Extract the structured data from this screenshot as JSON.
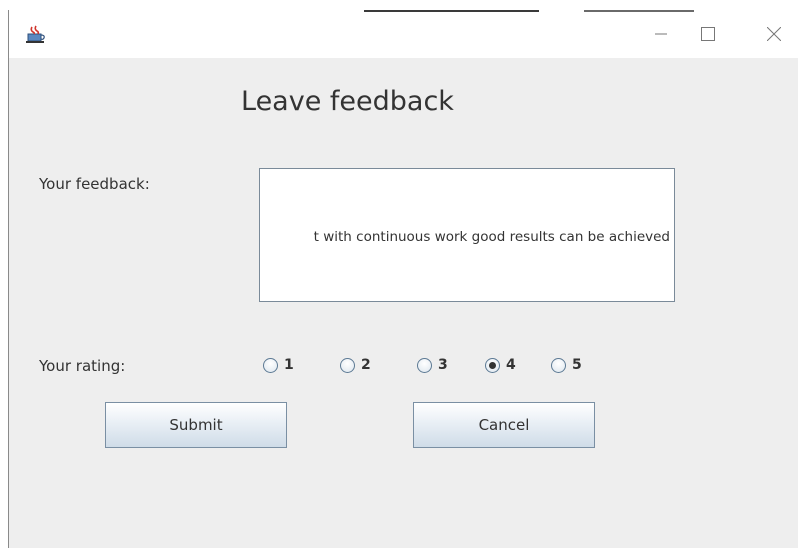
{
  "window": {
    "title_bar_icon": "java-cup-icon",
    "controls": [
      "minimize-icon",
      "maximize-icon",
      "close-icon"
    ]
  },
  "form": {
    "heading": "Leave feedback",
    "feedback_label": "Your feedback:",
    "feedback_value": "t with continuous work good results can be achieved",
    "rating_label": "Your rating:",
    "rating_options": [
      "1",
      "2",
      "3",
      "4",
      "5"
    ],
    "rating_selected": "4",
    "submit_label": "Submit",
    "cancel_label": "Cancel"
  },
  "colors": {
    "background": "#eeeeee",
    "titlebar": "#ffffff",
    "button_border": "#7a8fa3",
    "radio_border": "#5d7a94"
  }
}
